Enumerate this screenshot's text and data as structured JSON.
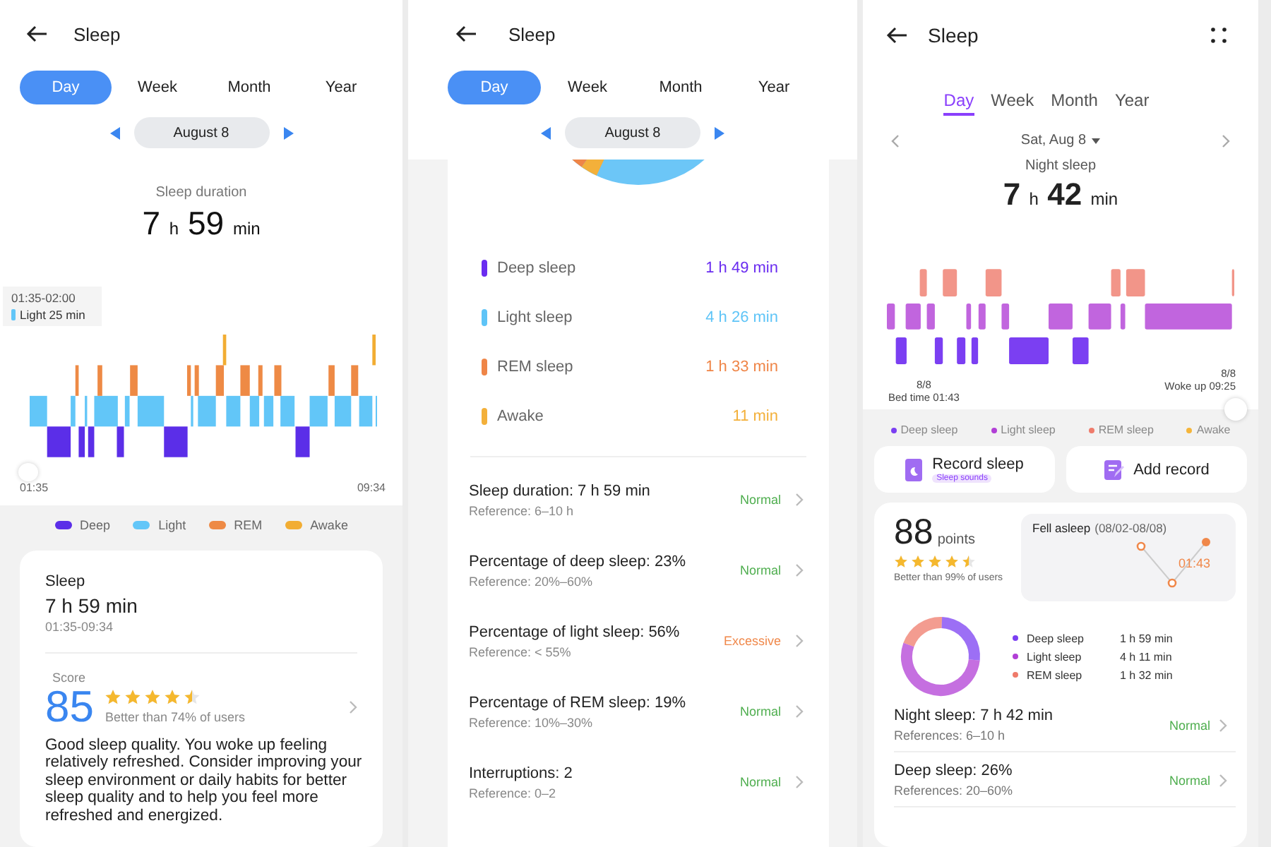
{
  "left_screen": {
    "title": "Sleep",
    "tabs": [
      {
        "label": "Day",
        "selected": true
      },
      {
        "label": "Week",
        "selected": false
      },
      {
        "label": "Month",
        "selected": false
      },
      {
        "label": "Year",
        "selected": false
      }
    ],
    "date": "August 8",
    "duration_label": "Sleep duration",
    "duration": "7 h 59 min",
    "tooltip": {
      "time": "01:35-02:00",
      "text": "Light 25 min"
    },
    "axis_start": "01:35",
    "axis_end": "09:34",
    "legend": [
      {
        "label": "Deep",
        "color": "#5b2ee8"
      },
      {
        "label": "Light",
        "color": "#62c6f8"
      },
      {
        "label": "REM",
        "color": "#ee8a45"
      },
      {
        "label": "Awake",
        "color": "#f2ad33"
      }
    ],
    "card": {
      "title": "Sleep",
      "duration": "7 h 59 min",
      "range": "01:35-09:34",
      "score_label": "Score",
      "score": "85",
      "stars": 4.5,
      "comparison": "Better than 74% of users",
      "summary": "Good sleep quality. You woke up feeling relatively refreshed. Consider improving your sleep environment or daily habits for better sleep quality and to help you feel more refreshed and energized."
    }
  },
  "middle_screen": {
    "title": "Sleep",
    "tabs": [
      {
        "label": "Day",
        "selected": true
      },
      {
        "label": "Week",
        "selected": false
      },
      {
        "label": "Month",
        "selected": false
      },
      {
        "label": "Year",
        "selected": false
      }
    ],
    "date": "August 8",
    "stages": [
      {
        "label": "Deep sleep",
        "value": "1 h 49 min",
        "color": "#6a2cf0"
      },
      {
        "label": "Light sleep",
        "value": "4 h 26 min",
        "color": "#5ec4f7"
      },
      {
        "label": "REM sleep",
        "value": "1 h 33 min",
        "color": "#ef8547"
      },
      {
        "label": "Awake",
        "value": "11 min",
        "color": "#f3b03a"
      }
    ],
    "metrics": [
      {
        "title": "Sleep duration: 7 h 59 min",
        "reference": "Reference: 6–10 h",
        "status": "Normal",
        "flagged": false
      },
      {
        "title": "Percentage of deep sleep: 23%",
        "reference": "Reference: 20%–60%",
        "status": "Normal",
        "flagged": false
      },
      {
        "title": "Percentage of light sleep: 56%",
        "reference": "Reference: < 55%",
        "status": "Excessive",
        "flagged": true
      },
      {
        "title": "Percentage of REM sleep: 19%",
        "reference": "Reference: 10%–30%",
        "status": "Normal",
        "flagged": false
      },
      {
        "title": "Interruptions: 2",
        "reference": "Reference: 0–2",
        "status": "Normal",
        "flagged": false
      }
    ]
  },
  "right_screen": {
    "title": "Sleep",
    "tabs": [
      {
        "label": "Day",
        "selected": true
      },
      {
        "label": "Week",
        "selected": false
      },
      {
        "label": "Month",
        "selected": false
      },
      {
        "label": "Year",
        "selected": false
      }
    ],
    "date": "Sat, Aug 8",
    "duration_label": "Night sleep",
    "duration": "7 h 42 min",
    "bed": {
      "date": "8/8",
      "label": "Bed time 01:43"
    },
    "wake": {
      "date": "8/8",
      "label": "Woke up 09:25"
    },
    "legend": [
      {
        "label": "Deep sleep",
        "color": "#7b3ff2"
      },
      {
        "label": "Light sleep",
        "color": "#b13fd6"
      },
      {
        "label": "REM sleep",
        "color": "#ef7b6b"
      },
      {
        "label": "Awake",
        "color": "#f5b53a"
      }
    ],
    "actions": [
      {
        "label": "Record sleep",
        "badge": "Sleep sounds",
        "kind": "record"
      },
      {
        "label": "Add record",
        "kind": "add"
      }
    ],
    "score": {
      "value": "88",
      "unit": "points",
      "stars": 4.5,
      "comparison": "Better than 99% of users"
    },
    "fell_asleep": {
      "title": "Fell asleep",
      "range": "(08/02-08/08)",
      "value": "01:43"
    },
    "breakdown": [
      {
        "label": "Deep sleep",
        "value": "1 h 59 min",
        "color": "#7b3ff2"
      },
      {
        "label": "Light sleep",
        "value": "4 h 11 min",
        "color": "#b13fd6"
      },
      {
        "label": "REM sleep",
        "value": "1 h 32 min",
        "color": "#ef7b6b"
      }
    ],
    "metrics": [
      {
        "title": "Night sleep: 7 h 42 min",
        "reference": "References: 6–10 h",
        "status": "Normal",
        "flagged": false
      },
      {
        "title": "Deep sleep: 26%",
        "reference": "References: 20–60%",
        "status": "Normal",
        "flagged": false
      }
    ]
  }
}
